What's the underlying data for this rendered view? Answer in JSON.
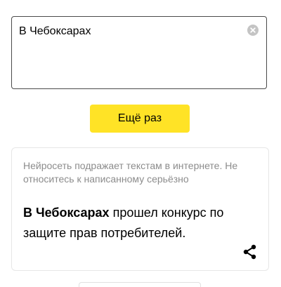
{
  "input": {
    "value": "В Чебоксарах",
    "clear_icon": "clear-circle-icon"
  },
  "again_button": {
    "label": "Ещё раз"
  },
  "result": {
    "disclaimer": "Нейросеть подражает текстам в интернете. Не относитесь к написанному серьёзно",
    "prompt_bold": "В Чебоксарах",
    "continuation": " прошел конкурс по защите прав потребителей.",
    "share_icon": "share-icon"
  },
  "colors": {
    "accent_button": "#ffe326",
    "border": "#4a4a4a",
    "muted_text": "#8c8c8c"
  }
}
